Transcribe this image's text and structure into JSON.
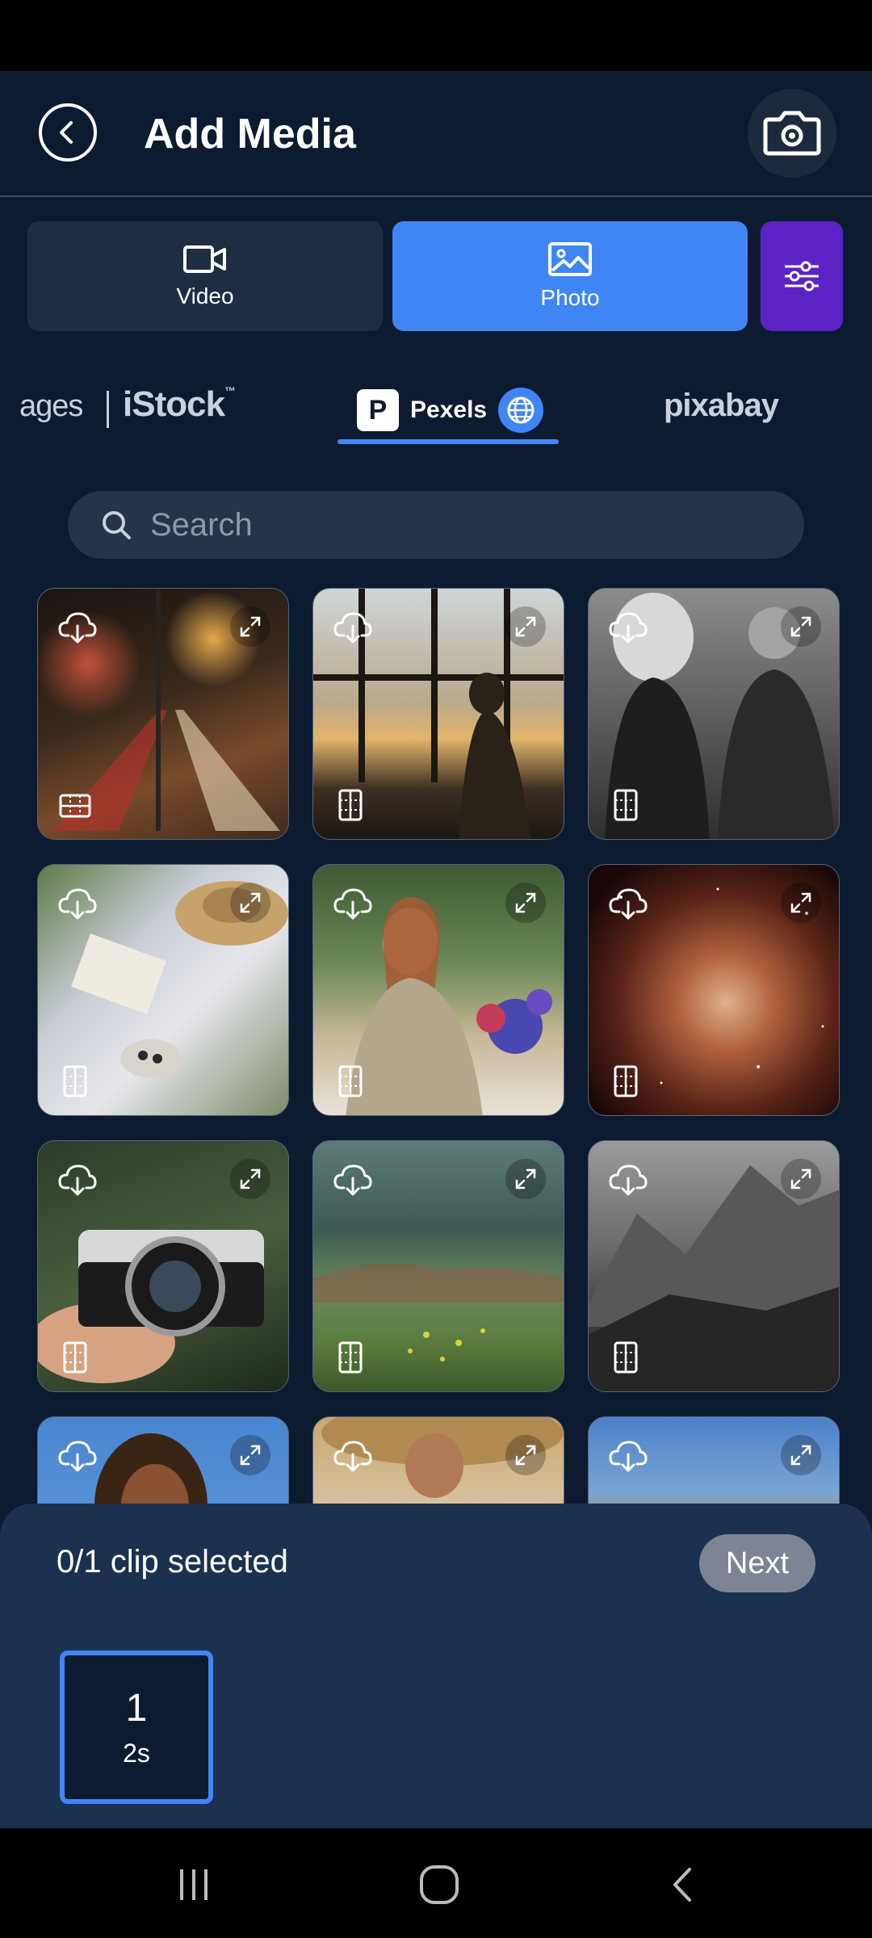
{
  "header": {
    "title": "Add Media"
  },
  "media_tabs": [
    {
      "label": "Video",
      "icon": "video-icon",
      "selected": false
    },
    {
      "label": "Photo",
      "icon": "image-icon",
      "selected": true
    }
  ],
  "providers": {
    "images_partial": "ages",
    "istock": "iStock",
    "istock_tm": "™",
    "pexels": "Pexels",
    "pixabay": "pixabay",
    "selected": "Pexels"
  },
  "search": {
    "placeholder": "Search",
    "value": ""
  },
  "grid": {
    "tiles": [
      "night-city-traffic",
      "airport-silhouettes",
      "elderly-couple",
      "picnic-hat-book",
      "woman-reading-flowers",
      "nebula-space",
      "hands-holding-camera",
      "green-meadow",
      "gray-mountains",
      "woman-braids",
      "man-straw-hat",
      "desert-mountains"
    ]
  },
  "selection": {
    "status": "0/1 clip selected",
    "next_label": "Next"
  },
  "clip_slot": {
    "number": "1",
    "duration": "2s"
  },
  "colors": {
    "accent": "#3f86f4",
    "filter": "#5b22c4",
    "background": "#0d1b30",
    "panel": "#1c3150"
  }
}
